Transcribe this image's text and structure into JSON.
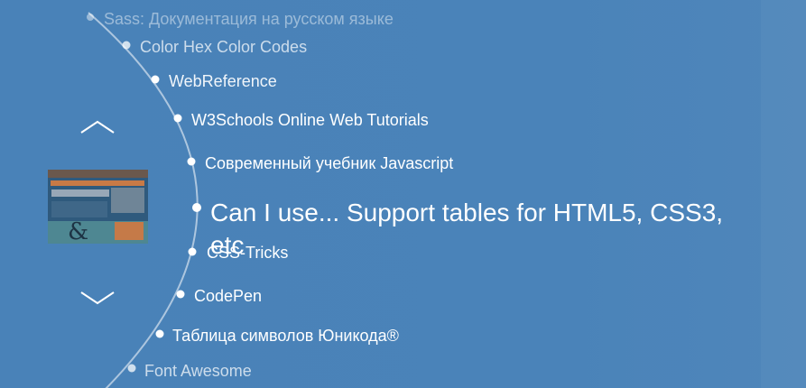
{
  "nav": {
    "up_icon": "chevron-up-icon",
    "down_icon": "chevron-down-icon"
  },
  "selected": {
    "thumbnail_label": "preview-thumbnail"
  },
  "links": [
    {
      "label": "Sass: Документация на русском языке"
    },
    {
      "label": "Color Hex Color Codes"
    },
    {
      "label": "WebReference"
    },
    {
      "label": "W3Schools Online Web Tutorials"
    },
    {
      "label": "Современный учебник Javascript"
    },
    {
      "label": "Can I use... Support tables for HTML5, CSS3, etc"
    },
    {
      "label": "CSS-Tricks"
    },
    {
      "label": "CodePen"
    },
    {
      "label": "Таблица символов Юникода®"
    },
    {
      "label": "Font Awesome"
    }
  ],
  "colors": {
    "background": "#4a80b4",
    "text": "#ffffff"
  }
}
